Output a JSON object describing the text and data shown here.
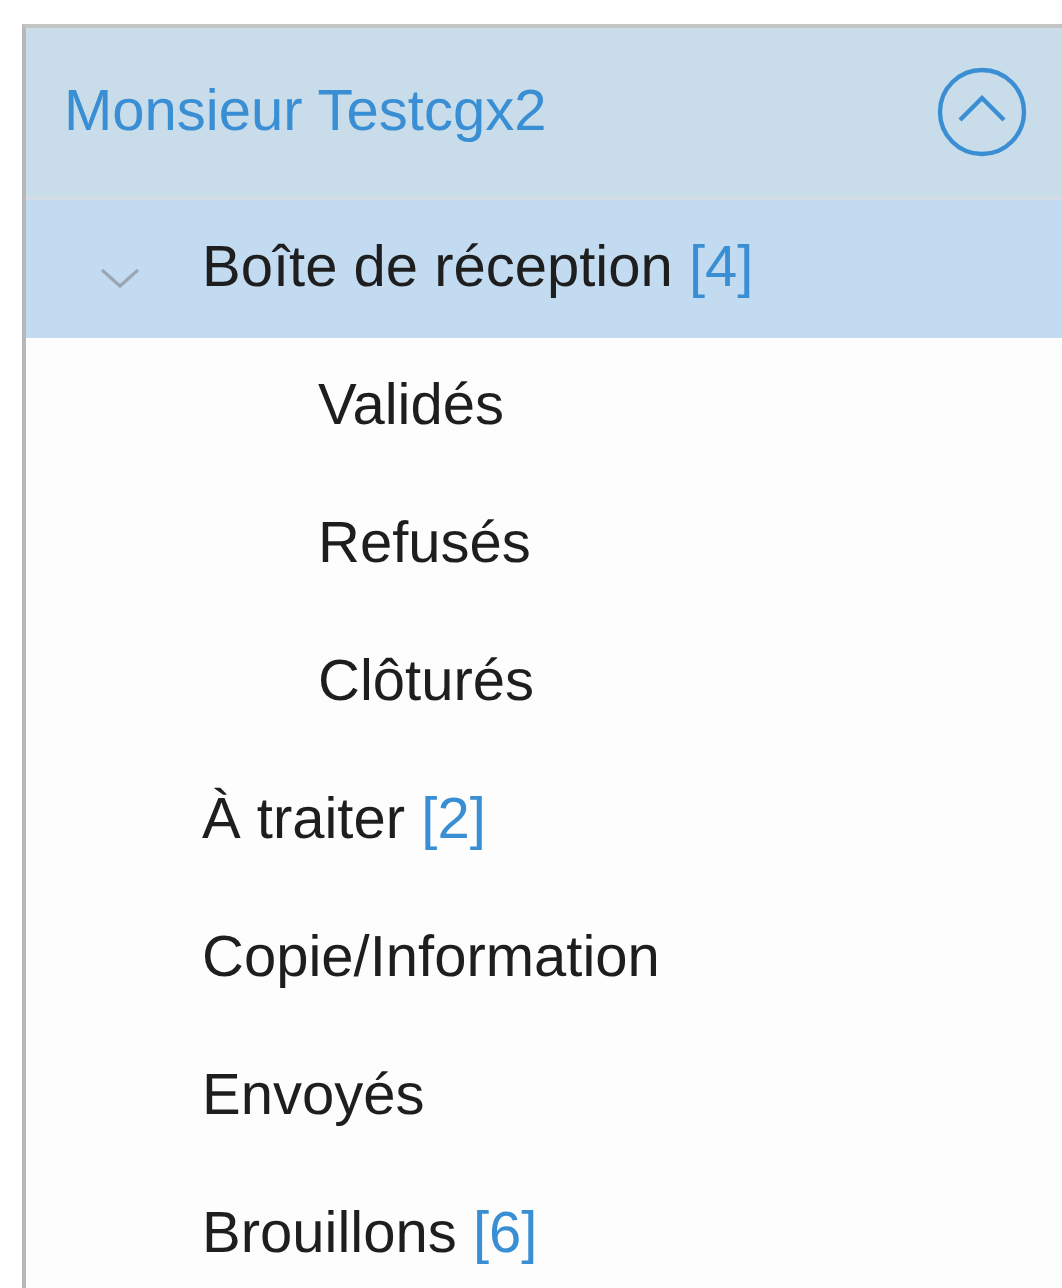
{
  "account": {
    "name": "Monsieur Testcgx2",
    "expanded": true
  },
  "folders": [
    {
      "label": "Boîte de réception",
      "count": "[4]",
      "selected": true,
      "expanded": true,
      "children": [
        {
          "label": "Validés",
          "selected": false
        },
        {
          "label": "Refusés",
          "selected": false
        },
        {
          "label": "Clôturés",
          "selected": false
        }
      ]
    },
    {
      "label": "À traiter",
      "count": "[2]",
      "selected": false
    },
    {
      "label": "Copie/Information",
      "selected": false
    },
    {
      "label": "Envoyés",
      "selected": false
    },
    {
      "label": "Brouillons",
      "count": "[6]",
      "selected": false
    }
  ]
}
